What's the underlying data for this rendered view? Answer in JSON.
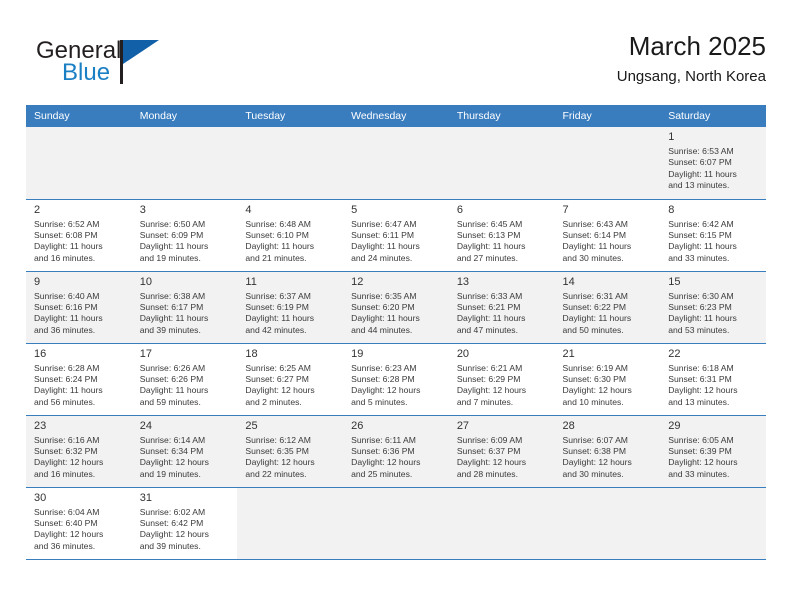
{
  "brand": {
    "name_part1": "General",
    "name_part2": "Blue",
    "flag_icon": "brand-flag-icon",
    "color_dark": "#231f20",
    "color_blue": "#1b7fc4"
  },
  "header": {
    "title": "March 2025",
    "subtitle": "Ungsang, North Korea"
  },
  "theme": {
    "header_bg": "#3a7dbf",
    "row_shaded_bg": "#f2f2f2",
    "row_plain_bg": "#ffffff",
    "grid_line": "#3a7dbf"
  },
  "weekdays": [
    "Sunday",
    "Monday",
    "Tuesday",
    "Wednesday",
    "Thursday",
    "Friday",
    "Saturday"
  ],
  "labels": {
    "sunrise_prefix": "Sunrise:",
    "sunset_prefix": "Sunset:",
    "daylight_prefix": "Daylight:"
  },
  "weeks": [
    {
      "shaded": true,
      "days": [
        {
          "empty": true
        },
        {
          "empty": true
        },
        {
          "empty": true
        },
        {
          "empty": true
        },
        {
          "empty": true
        },
        {
          "empty": true
        },
        {
          "day": "1",
          "sunrise": "Sunrise: 6:53 AM",
          "sunset": "Sunset: 6:07 PM",
          "daylight_line1": "Daylight: 11 hours",
          "daylight_line2": "and 13 minutes."
        }
      ]
    },
    {
      "shaded": false,
      "days": [
        {
          "day": "2",
          "sunrise": "Sunrise: 6:52 AM",
          "sunset": "Sunset: 6:08 PM",
          "daylight_line1": "Daylight: 11 hours",
          "daylight_line2": "and 16 minutes."
        },
        {
          "day": "3",
          "sunrise": "Sunrise: 6:50 AM",
          "sunset": "Sunset: 6:09 PM",
          "daylight_line1": "Daylight: 11 hours",
          "daylight_line2": "and 19 minutes."
        },
        {
          "day": "4",
          "sunrise": "Sunrise: 6:48 AM",
          "sunset": "Sunset: 6:10 PM",
          "daylight_line1": "Daylight: 11 hours",
          "daylight_line2": "and 21 minutes."
        },
        {
          "day": "5",
          "sunrise": "Sunrise: 6:47 AM",
          "sunset": "Sunset: 6:11 PM",
          "daylight_line1": "Daylight: 11 hours",
          "daylight_line2": "and 24 minutes."
        },
        {
          "day": "6",
          "sunrise": "Sunrise: 6:45 AM",
          "sunset": "Sunset: 6:13 PM",
          "daylight_line1": "Daylight: 11 hours",
          "daylight_line2": "and 27 minutes."
        },
        {
          "day": "7",
          "sunrise": "Sunrise: 6:43 AM",
          "sunset": "Sunset: 6:14 PM",
          "daylight_line1": "Daylight: 11 hours",
          "daylight_line2": "and 30 minutes."
        },
        {
          "day": "8",
          "sunrise": "Sunrise: 6:42 AM",
          "sunset": "Sunset: 6:15 PM",
          "daylight_line1": "Daylight: 11 hours",
          "daylight_line2": "and 33 minutes."
        }
      ]
    },
    {
      "shaded": true,
      "days": [
        {
          "day": "9",
          "sunrise": "Sunrise: 6:40 AM",
          "sunset": "Sunset: 6:16 PM",
          "daylight_line1": "Daylight: 11 hours",
          "daylight_line2": "and 36 minutes."
        },
        {
          "day": "10",
          "sunrise": "Sunrise: 6:38 AM",
          "sunset": "Sunset: 6:17 PM",
          "daylight_line1": "Daylight: 11 hours",
          "daylight_line2": "and 39 minutes."
        },
        {
          "day": "11",
          "sunrise": "Sunrise: 6:37 AM",
          "sunset": "Sunset: 6:19 PM",
          "daylight_line1": "Daylight: 11 hours",
          "daylight_line2": "and 42 minutes."
        },
        {
          "day": "12",
          "sunrise": "Sunrise: 6:35 AM",
          "sunset": "Sunset: 6:20 PM",
          "daylight_line1": "Daylight: 11 hours",
          "daylight_line2": "and 44 minutes."
        },
        {
          "day": "13",
          "sunrise": "Sunrise: 6:33 AM",
          "sunset": "Sunset: 6:21 PM",
          "daylight_line1": "Daylight: 11 hours",
          "daylight_line2": "and 47 minutes."
        },
        {
          "day": "14",
          "sunrise": "Sunrise: 6:31 AM",
          "sunset": "Sunset: 6:22 PM",
          "daylight_line1": "Daylight: 11 hours",
          "daylight_line2": "and 50 minutes."
        },
        {
          "day": "15",
          "sunrise": "Sunrise: 6:30 AM",
          "sunset": "Sunset: 6:23 PM",
          "daylight_line1": "Daylight: 11 hours",
          "daylight_line2": "and 53 minutes."
        }
      ]
    },
    {
      "shaded": false,
      "days": [
        {
          "day": "16",
          "sunrise": "Sunrise: 6:28 AM",
          "sunset": "Sunset: 6:24 PM",
          "daylight_line1": "Daylight: 11 hours",
          "daylight_line2": "and 56 minutes."
        },
        {
          "day": "17",
          "sunrise": "Sunrise: 6:26 AM",
          "sunset": "Sunset: 6:26 PM",
          "daylight_line1": "Daylight: 11 hours",
          "daylight_line2": "and 59 minutes."
        },
        {
          "day": "18",
          "sunrise": "Sunrise: 6:25 AM",
          "sunset": "Sunset: 6:27 PM",
          "daylight_line1": "Daylight: 12 hours",
          "daylight_line2": "and 2 minutes."
        },
        {
          "day": "19",
          "sunrise": "Sunrise: 6:23 AM",
          "sunset": "Sunset: 6:28 PM",
          "daylight_line1": "Daylight: 12 hours",
          "daylight_line2": "and 5 minutes."
        },
        {
          "day": "20",
          "sunrise": "Sunrise: 6:21 AM",
          "sunset": "Sunset: 6:29 PM",
          "daylight_line1": "Daylight: 12 hours",
          "daylight_line2": "and 7 minutes."
        },
        {
          "day": "21",
          "sunrise": "Sunrise: 6:19 AM",
          "sunset": "Sunset: 6:30 PM",
          "daylight_line1": "Daylight: 12 hours",
          "daylight_line2": "and 10 minutes."
        },
        {
          "day": "22",
          "sunrise": "Sunrise: 6:18 AM",
          "sunset": "Sunset: 6:31 PM",
          "daylight_line1": "Daylight: 12 hours",
          "daylight_line2": "and 13 minutes."
        }
      ]
    },
    {
      "shaded": true,
      "days": [
        {
          "day": "23",
          "sunrise": "Sunrise: 6:16 AM",
          "sunset": "Sunset: 6:32 PM",
          "daylight_line1": "Daylight: 12 hours",
          "daylight_line2": "and 16 minutes."
        },
        {
          "day": "24",
          "sunrise": "Sunrise: 6:14 AM",
          "sunset": "Sunset: 6:34 PM",
          "daylight_line1": "Daylight: 12 hours",
          "daylight_line2": "and 19 minutes."
        },
        {
          "day": "25",
          "sunrise": "Sunrise: 6:12 AM",
          "sunset": "Sunset: 6:35 PM",
          "daylight_line1": "Daylight: 12 hours",
          "daylight_line2": "and 22 minutes."
        },
        {
          "day": "26",
          "sunrise": "Sunrise: 6:11 AM",
          "sunset": "Sunset: 6:36 PM",
          "daylight_line1": "Daylight: 12 hours",
          "daylight_line2": "and 25 minutes."
        },
        {
          "day": "27",
          "sunrise": "Sunrise: 6:09 AM",
          "sunset": "Sunset: 6:37 PM",
          "daylight_line1": "Daylight: 12 hours",
          "daylight_line2": "and 28 minutes."
        },
        {
          "day": "28",
          "sunrise": "Sunrise: 6:07 AM",
          "sunset": "Sunset: 6:38 PM",
          "daylight_line1": "Daylight: 12 hours",
          "daylight_line2": "and 30 minutes."
        },
        {
          "day": "29",
          "sunrise": "Sunrise: 6:05 AM",
          "sunset": "Sunset: 6:39 PM",
          "daylight_line1": "Daylight: 12 hours",
          "daylight_line2": "and 33 minutes."
        }
      ]
    },
    {
      "shaded": false,
      "days": [
        {
          "day": "30",
          "sunrise": "Sunrise: 6:04 AM",
          "sunset": "Sunset: 6:40 PM",
          "daylight_line1": "Daylight: 12 hours",
          "daylight_line2": "and 36 minutes."
        },
        {
          "day": "31",
          "sunrise": "Sunrise: 6:02 AM",
          "sunset": "Sunset: 6:42 PM",
          "daylight_line1": "Daylight: 12 hours",
          "daylight_line2": "and 39 minutes."
        },
        {
          "empty": true
        },
        {
          "empty": true
        },
        {
          "empty": true
        },
        {
          "empty": true
        },
        {
          "empty": true
        }
      ]
    }
  ]
}
